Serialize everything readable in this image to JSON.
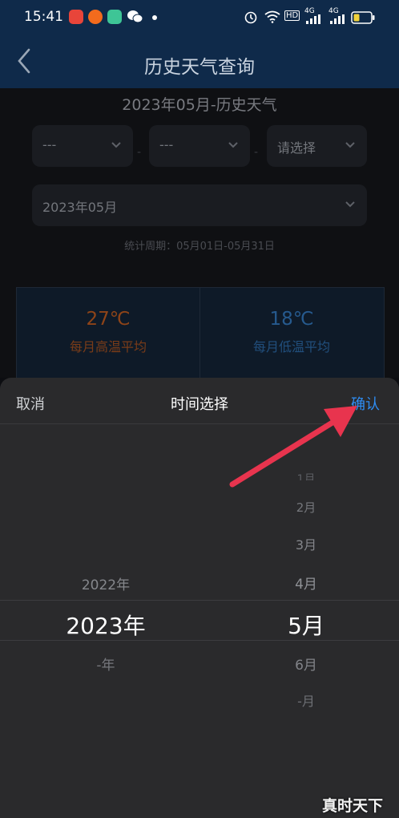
{
  "status_bar": {
    "time": "15:41",
    "network_left": "4G",
    "network_right": "4G",
    "hd_label": "HD",
    "icons": [
      "news-app-icon",
      "weibo-app-icon",
      "message-app-icon",
      "wechat-icon",
      "alarm-icon",
      "wifi-icon",
      "signal-icon",
      "battery-icon"
    ],
    "battery_level": 0.35
  },
  "header": {
    "title": "历史天气查询",
    "back_icon": "chevron-left-icon"
  },
  "page": {
    "subtitle": "2023年05月-历史天气",
    "selects": {
      "province": "---",
      "city": "---",
      "district": "请选择",
      "month": "2023年05月"
    },
    "separator": "-",
    "period": "统计周期：05月01日-05月31日",
    "stats": {
      "high_value": "27℃",
      "high_label": "每月高温平均",
      "low_value": "18℃",
      "low_label": "每月低温平均"
    }
  },
  "picker": {
    "cancel": "取消",
    "title": "时间选择",
    "confirm": "确认",
    "years": {
      "above": "2022年",
      "selected": "2023年",
      "below": "-年"
    },
    "months": {
      "far_above": "1月",
      "above3": "2月",
      "above2": "3月",
      "above1": "4月",
      "selected": "5月",
      "below1": "6月",
      "below2": "-月"
    }
  },
  "colors": {
    "header_bg": "#0f2a4a",
    "high_temp": "#c95a1a",
    "low_temp": "#2f6fb3",
    "confirm_blue": "#2f8ef5",
    "arrow_red": "#e8344e"
  },
  "watermark": "真时天下"
}
